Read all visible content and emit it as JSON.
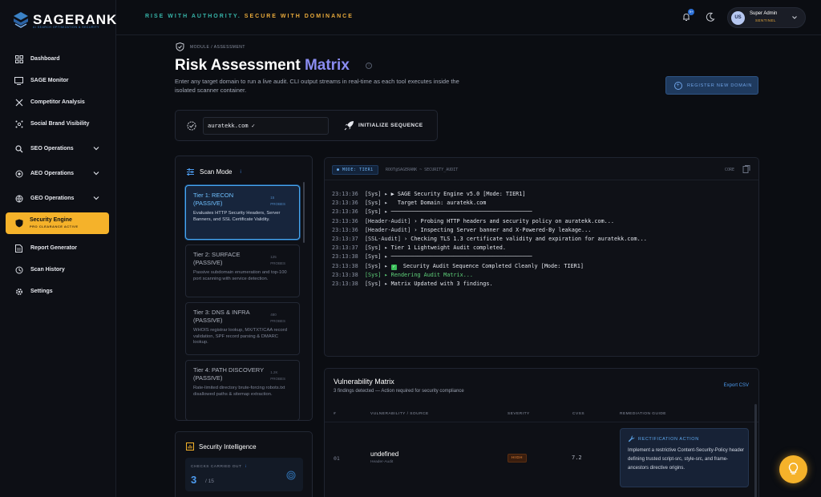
{
  "brand": {
    "name": "SAGERANK",
    "tag": "AI SEARCH OPTIMIZATION & SECURITY"
  },
  "tagline": {
    "part1": "RISE WITH AUTHORITY. ",
    "part2": "SECURE WITH DOMINANCE"
  },
  "sidebar": {
    "items": [
      {
        "label": "Dashboard",
        "icon": "grid-icon"
      },
      {
        "label": "SAGE Monitor",
        "icon": "monitor-icon"
      },
      {
        "label": "Competitor Analysis",
        "icon": "swords-icon"
      },
      {
        "label": "Social Brand Visibility",
        "icon": "network-icon"
      },
      {
        "label": "SEO Operations",
        "icon": "search-icon"
      },
      {
        "label": "AEO Operations",
        "icon": "target-icon"
      },
      {
        "label": "GEO Operations",
        "icon": "globe-icon"
      },
      {
        "label": "Security Engine",
        "sub": "PRO CLEARANCE ACTIVE",
        "icon": "shield-icon"
      },
      {
        "label": "Report Generator",
        "icon": "file-icon"
      },
      {
        "label": "Scan History",
        "icon": "history-icon"
      },
      {
        "label": "Settings",
        "icon": "gear-icon"
      }
    ]
  },
  "topbar": {
    "badge": "9+",
    "user_initials": "US",
    "user_name": "Super Admin",
    "user_role": "SENTINEL"
  },
  "page": {
    "breadcrumb": "MODULE / ASSESSMENT",
    "title_main": "Risk Assessment ",
    "title_accent": "Matrix",
    "info": "i",
    "description": "Enter any target domain to run a live audit. CLI output streams in real-time as each tool executes inside the isolated scanner container.",
    "register_button": "REGISTER NEW DOMAIN"
  },
  "target": {
    "value": "auratekk.com ✓",
    "init_button": "INITIALIZE SEQUENCE"
  },
  "scan_mode": {
    "title": "Scan Mode",
    "info": "i",
    "tiers": [
      {
        "name": "Tier 1: RECON (PASSIVE)",
        "probes_count": "15",
        "probes_label": "PROBES",
        "desc": "Evaluates HTTP Security Headers, Server Banners, and SSL Certificate Validity."
      },
      {
        "name": "Tier 2: SURFACE (PASSIVE)",
        "probes_count": "125",
        "probes_label": "PROBES",
        "desc": "Passive subdomain enumeration and top-100 port scanning with service detection."
      },
      {
        "name": "Tier 3: DNS & INFRA (PASSIVE)",
        "probes_count": "480",
        "probes_label": "PROBES",
        "desc": "WHOIS registrar lookup, MX/TXT/CAA record validation, SPF record parsing & DMARC lookup."
      },
      {
        "name": "Tier 4: PATH DISCOVERY (PASSIVE)",
        "probes_count": "1.2K",
        "probes_label": "PROBES",
        "desc": "Rate-limited directory brute-forcing robots.txt disallowed paths & sitemap extraction."
      }
    ]
  },
  "intel": {
    "title": "Security Intelligence",
    "label": "CHECKS CARRIED OUT",
    "info": "i",
    "value": "3",
    "total": "/ 15"
  },
  "terminal": {
    "mode": "● MODE: TIER1",
    "path": "ROOT@SAGERANK ~ SECURITY_AUDIT",
    "copy": "CORE",
    "lines": [
      {
        "ts": "23:13:36",
        "sys": "[Sys] ▸",
        "msg": " ▶ SAGE Security Engine v5.0 [Mode: TIER1]",
        "kind": "plain"
      },
      {
        "ts": "23:13:36",
        "sys": "[Sys] ▸",
        "msg": "   Target Domain: auratekk.com",
        "kind": "plain"
      },
      {
        "ts": "23:13:36",
        "sys": "[Sys] ▸",
        "msg": " ───────────────────────────────────────────",
        "kind": "plain"
      },
      {
        "ts": "23:13:36",
        "sys": "[Header-Audit]",
        "msg": " › Probing HTTP headers and security policy on auratekk.com...",
        "kind": "plain"
      },
      {
        "ts": "23:13:36",
        "sys": "[Header-Audit]",
        "msg": " › Inspecting Server banner and X-Powered-By leakage...",
        "kind": "plain"
      },
      {
        "ts": "23:13:37",
        "sys": "[SSL-Audit]",
        "msg": " › Checking TLS 1.3 certificate validity and expiration for auratekk.com...",
        "kind": "plain"
      },
      {
        "ts": "23:13:37",
        "sys": "[Sys] ▸",
        "msg": " Tier 1 Lightweight Audit completed.",
        "kind": "plain"
      },
      {
        "ts": "23:13:38",
        "sys": "[Sys] ▸",
        "msg": " ───────────────────────────────────────────",
        "kind": "plain"
      },
      {
        "ts": "23:13:38",
        "sys": "[Sys] ▸",
        "msg": "  Security Audit Sequence Completed Cleanly [Mode: TIER1]",
        "kind": "check"
      },
      {
        "ts": "23:13:38",
        "sys": "[Sys] ▸",
        "msg": " Rendering Audit Matrix...",
        "kind": "green"
      },
      {
        "ts": "23:13:38",
        "sys": "[Sys] ▸",
        "msg": " Matrix Updated with 3 findings.",
        "kind": "plain"
      }
    ]
  },
  "vuln": {
    "title": "Vulnerability Matrix",
    "subtitle": "3 findings detected — Action required for security compliance",
    "export": "Export CSV",
    "columns": [
      "#",
      "VULNERABILITY / SOURCE",
      "SEVERITY",
      "CVSS",
      "REMEDIATION GUIDE"
    ],
    "rows": [
      {
        "idx": "01",
        "name": "undefined",
        "source": "Header-Audit",
        "severity": "HIGH",
        "cvss": "7.2",
        "rem_title": "RECTIFICATION ACTION",
        "rem_text": "Implement a restrictive Content-Security-Policy header defining trusted script-src, style-src, and frame-ancestors directive origins."
      }
    ]
  },
  "colors": {
    "accent": "#f5b22a",
    "brand_blue": "#3b82c6",
    "tier_selected": "#48a7f0",
    "success": "#5fd27a",
    "severity_high": "#f08a3a"
  }
}
